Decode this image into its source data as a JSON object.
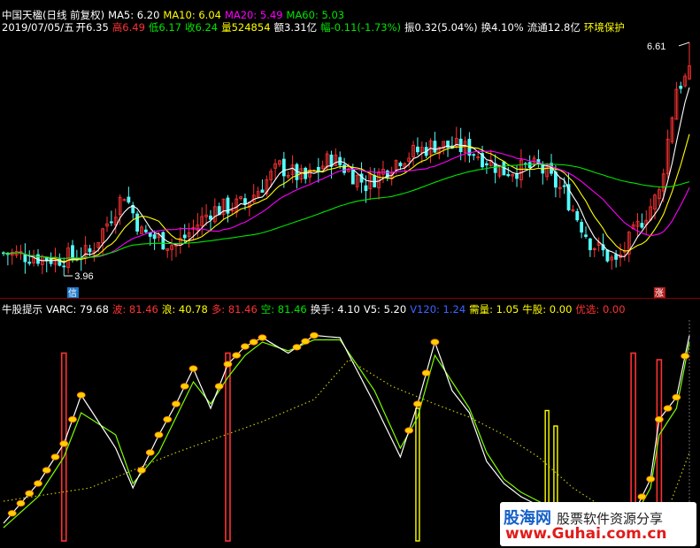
{
  "header": {
    "title": "中国天楹(日线 前复权)",
    "ma5": "MA5: 6.20",
    "ma10": "MA10: 6.04",
    "ma20": "MA20: 5.49",
    "ma60": "MA60: 5.03",
    "date": "2019/07/05/五",
    "open": "开6.35",
    "high": "高6.49",
    "low": "低6.17",
    "close": "收6.24",
    "volume": "量524854",
    "amount": "额3.31亿",
    "change": "幅-0.11(-1.73%)",
    "amplitude": "振0.32(5.04%)",
    "turnover": "换4.10%",
    "float": "流通12.8亿",
    "tag": "环境保护"
  },
  "indicator": {
    "name": "牛股提示",
    "varc": "VARC: 79.68",
    "bo": "波: 81.46",
    "lang": "浪: 40.78",
    "duo": "多: 81.46",
    "kong": "空: 81.46",
    "huanshou": "换手: 4.10",
    "v5": "V5: 5.20",
    "v120": "V120: 1.24",
    "xuliang": "需量: 1.05",
    "niugu": "牛股: 0.00",
    "youxuan": "优选: 0.00"
  },
  "annotations": {
    "max_price": "6.61",
    "min_price": "3.96",
    "sell_badge": "信",
    "rise_badge": "涨"
  },
  "watermark": {
    "brand": "股海网",
    "slogan": "股票软件资源分享",
    "url": "www.Guhai.com.cn"
  },
  "colors": {
    "bg": "#000000",
    "up": "#ff3232",
    "down": "#54fcfc",
    "ma5": "#ffffff",
    "ma10": "#ffff00",
    "ma20": "#ff00ff",
    "ma60": "#00e600",
    "wave_white": "#ffffff",
    "wave_green": "#7cfc00",
    "dots": "#c8c800"
  },
  "chart_data": [
    {
      "type": "candlestick",
      "title": "中国天楹(日线 前复权)",
      "n": 160,
      "ylim": [
        3.8,
        6.75
      ],
      "max": 6.61,
      "min": 3.96,
      "close_anchors": [
        [
          0,
          4.22
        ],
        [
          12,
          4.15
        ],
        [
          20,
          4.22
        ],
        [
          28,
          4.9
        ],
        [
          32,
          4.45
        ],
        [
          40,
          4.3
        ],
        [
          48,
          4.7
        ],
        [
          56,
          4.78
        ],
        [
          64,
          5.2
        ],
        [
          70,
          5.05
        ],
        [
          76,
          5.3
        ],
        [
          84,
          5.0
        ],
        [
          92,
          5.3
        ],
        [
          100,
          5.45
        ],
        [
          108,
          5.4
        ],
        [
          116,
          5.15
        ],
        [
          124,
          5.2
        ],
        [
          130,
          4.9
        ],
        [
          136,
          4.35
        ],
        [
          142,
          4.1
        ],
        [
          148,
          4.6
        ],
        [
          152,
          4.9
        ],
        [
          156,
          6.1
        ],
        [
          159,
          6.24
        ]
      ],
      "ma_series": [
        "MA5",
        "MA10",
        "MA20",
        "MA60"
      ]
    },
    {
      "type": "line",
      "title": "牛股提示",
      "ylim": [
        0,
        100
      ],
      "x": [
        0,
        8,
        14,
        18,
        26,
        30,
        36,
        40,
        44,
        48,
        52,
        56,
        60,
        66,
        72,
        78,
        86,
        92,
        96,
        100,
        104,
        108,
        112,
        116,
        120,
        126,
        130,
        134,
        138,
        142,
        146,
        150,
        152,
        156,
        159
      ],
      "white": [
        8,
        26,
        44,
        66,
        42,
        24,
        48,
        62,
        78,
        60,
        80,
        88,
        92,
        85,
        93,
        92,
        62,
        38,
        62,
        90,
        68,
        58,
        36,
        26,
        20,
        14,
        6,
        4,
        5,
        3,
        12,
        28,
        55,
        65,
        93
      ],
      "green": [
        6,
        20,
        38,
        58,
        48,
        26,
        40,
        56,
        72,
        62,
        74,
        84,
        90,
        86,
        91,
        91,
        68,
        42,
        56,
        84,
        72,
        60,
        40,
        28,
        22,
        16,
        8,
        5,
        5,
        4,
        10,
        24,
        48,
        60,
        90
      ],
      "dots_x": [
        0,
        20,
        40,
        60,
        72,
        80,
        90,
        100,
        108,
        116,
        124,
        132,
        140,
        148,
        154,
        159
      ],
      "dots": [
        18,
        24,
        40,
        54,
        64,
        82,
        70,
        62,
        56,
        48,
        38,
        24,
        14,
        10,
        14,
        40
      ],
      "red_bars": [
        [
          14,
          85
        ],
        [
          52,
          85
        ],
        [
          146,
          85
        ],
        [
          152,
          82
        ]
      ],
      "yellow_bars": [
        [
          96,
          60
        ],
        [
          126,
          59
        ],
        [
          128,
          52
        ]
      ],
      "cursor_x": 159
    }
  ]
}
